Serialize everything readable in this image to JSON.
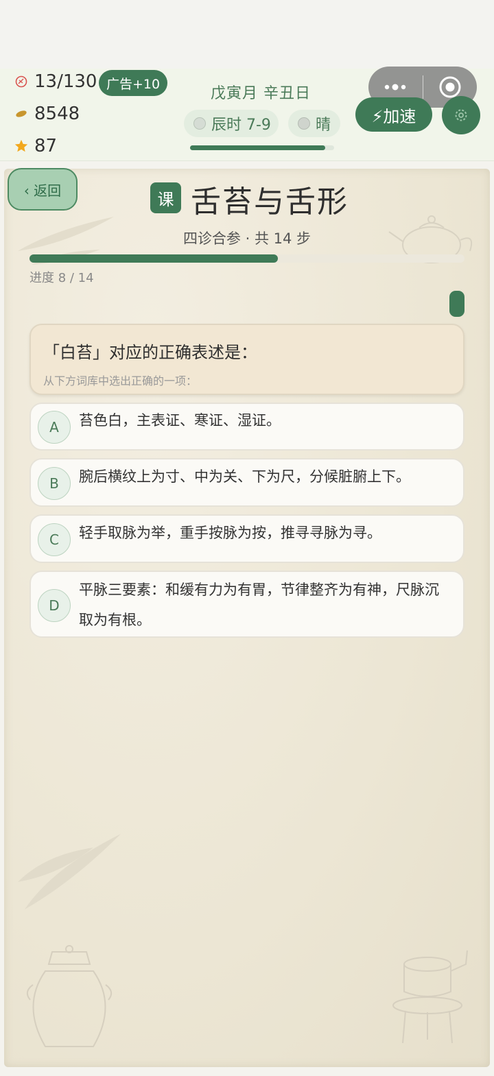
{
  "colors": {
    "accent": "#3f7a57",
    "paper": "#ece6d4",
    "question_bg": "#f2e7d3"
  },
  "status": {
    "energy": "13/130",
    "coins": "8548",
    "stars": "87",
    "ad_button": "广告+10",
    "date": "戊寅月 辛丑日",
    "time_label": "辰时 7-9",
    "weather": "晴",
    "day_progress": 0.94,
    "speed_button": "⚡加速"
  },
  "nav": {
    "back": "‹ 返回"
  },
  "lesson": {
    "tag": "课",
    "title": "舌苔与舌形",
    "subtitle": "四诊合参 · 共 14 步",
    "progress_label": "进度 8 / 14",
    "progress_current": 8,
    "progress_total": 14
  },
  "question": {
    "prompt": "「白苔」对应的正确表述是：",
    "hint": "从下方词库中选出正确的一项："
  },
  "options": [
    {
      "letter": "A",
      "text": "苔色白，主表证、寒证、湿证。"
    },
    {
      "letter": "B",
      "text": "腕后横纹上为寸、中为关、下为尺，分候脏腑上下。"
    },
    {
      "letter": "C",
      "text": "轻手取脉为举，重手按脉为按，推寻寻脉为寻。"
    },
    {
      "letter": "D",
      "text": "平脉三要素：和缓有力为有胃，节律整齐为有神，尺脉沉取为有根。"
    }
  ],
  "icons": [
    "energy-icon",
    "coin-icon",
    "star-icon",
    "clock-icon",
    "weather-icon",
    "more-icon",
    "close-icon",
    "gear-icon"
  ]
}
